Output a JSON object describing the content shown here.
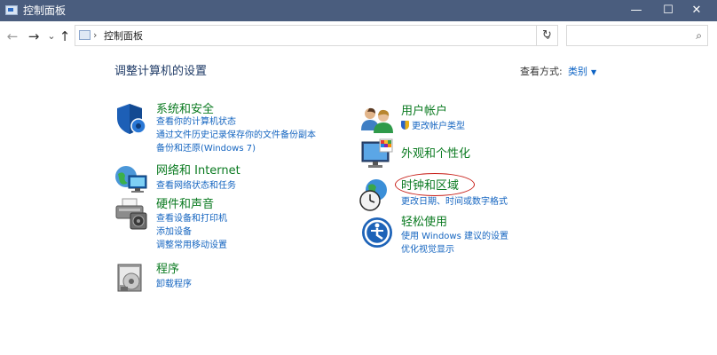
{
  "window": {
    "title": "控制面板",
    "buttons": {
      "minimize": "—",
      "maximize": "☐",
      "close": "✕"
    }
  },
  "nav": {
    "back": "←",
    "forward": "→",
    "recent": "⌄",
    "up": "↑"
  },
  "address": {
    "path": "控制面板",
    "separator": "›",
    "dropdown": "⌄",
    "refresh": "↻"
  },
  "search": {
    "value": "",
    "placeholder": "",
    "icon": "⌕"
  },
  "main": {
    "heading": "调整计算机的设置",
    "view_by_label": "查看方式:",
    "view_by_value": "类别",
    "view_by_arrow": "▼"
  },
  "categories": {
    "system": {
      "title": "系统和安全",
      "icon": "shield-icon",
      "links": [
        "查看你的计算机状态",
        "通过文件历史记录保存你的文件备份副本",
        "备份和还原(Windows 7)"
      ]
    },
    "network": {
      "title": "网络和 Internet",
      "icon": "network-icon",
      "links": [
        "查看网络状态和任务"
      ]
    },
    "hardware": {
      "title": "硬件和声音",
      "icon": "printer-icon",
      "links": [
        "查看设备和打印机",
        "添加设备",
        "调整常用移动设置"
      ]
    },
    "programs": {
      "title": "程序",
      "icon": "programs-icon",
      "links": [
        "卸载程序"
      ]
    },
    "user": {
      "title": "用户帐户",
      "icon": "users-icon",
      "links": [
        "更改帐户类型"
      ]
    },
    "appearance": {
      "title": "外观和个性化",
      "icon": "monitor-icon",
      "links": []
    },
    "clock": {
      "title": "时钟和区域",
      "icon": "clock-globe-icon",
      "links": [
        "更改日期、时间或数字格式"
      ]
    },
    "ease": {
      "title": "轻松使用",
      "icon": "ease-of-access-icon",
      "links": [
        "使用 Windows 建议的设置",
        "优化视觉显示"
      ]
    }
  },
  "colors": {
    "titlebar": "#4a5d7e",
    "category_title": "#0a7a20",
    "link": "#1565c0",
    "annotation_circle": "#c8201a"
  }
}
